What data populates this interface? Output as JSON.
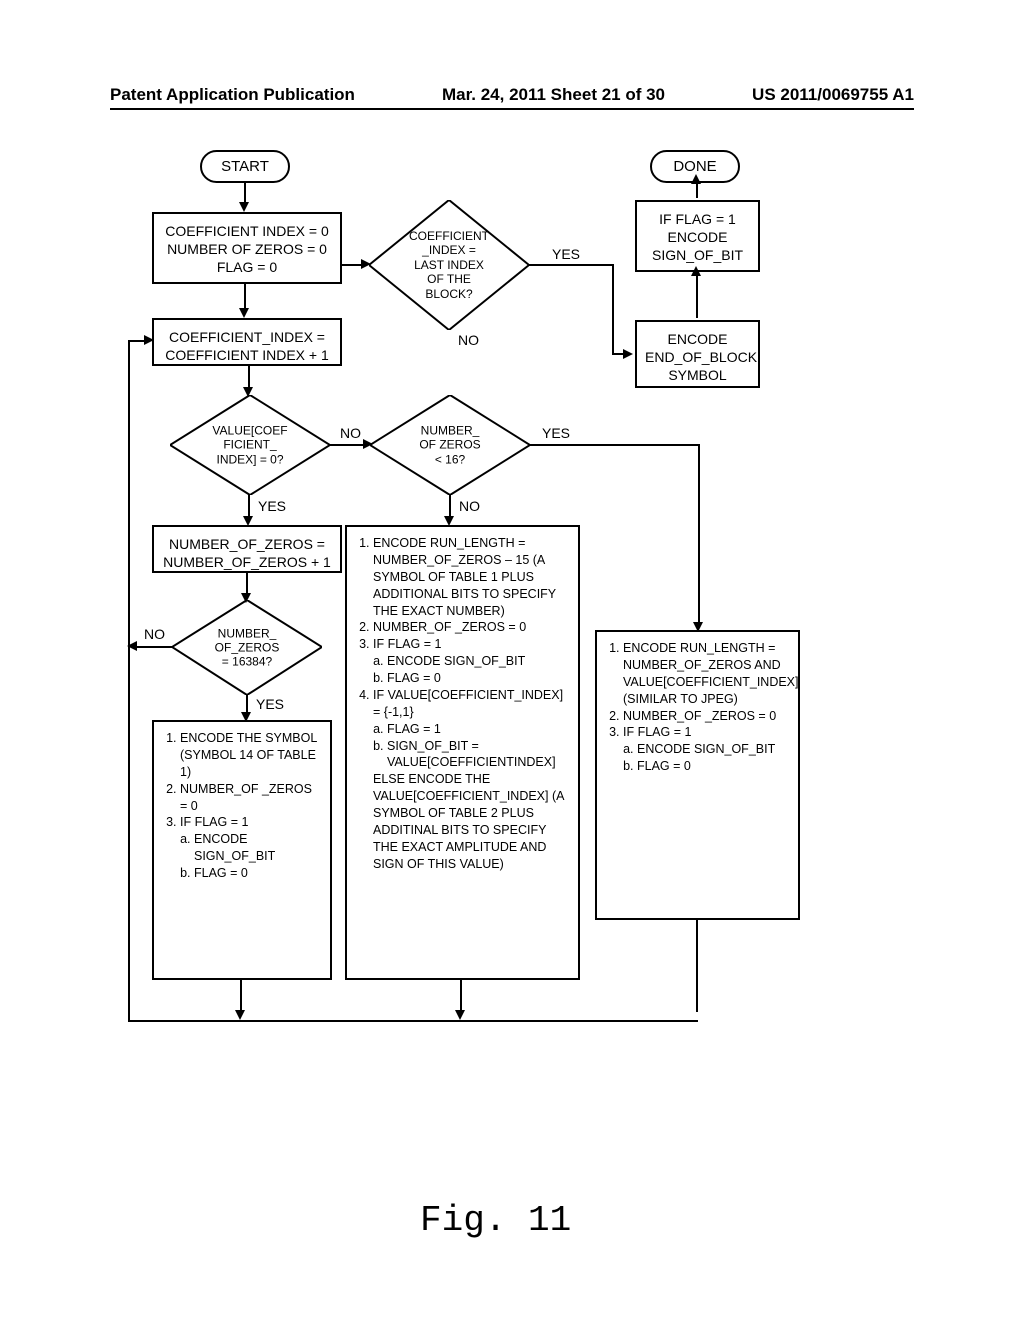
{
  "header": {
    "left": "Patent Application Publication",
    "center": "Mar. 24, 2011  Sheet 21 of 30",
    "right": "US 2011/0069755 A1"
  },
  "figure_caption": "Fig. 11",
  "nodes": {
    "start": "START",
    "done": "DONE",
    "init": "COEFFICIENT INDEX = 0\nNUMBER OF ZEROS = 0\nFLAG = 0",
    "increment": "COEFFICIENT_INDEX =\nCOEFFICIENT INDEX + 1",
    "last_index_q": "COEFFICIENT\n_INDEX =\nLAST INDEX\nOF THE\nBLOCK?",
    "flag_encode": "IF FLAG = 1\nENCODE\nSIGN_OF_BIT",
    "encode_eob": "ENCODE\nEND_OF_BLOCK\nSYMBOL",
    "value_zero_q": "VALUE[COEF\nFICIENT_\nINDEX] = 0?",
    "zeros_lt16_q": "NUMBER_\nOF ZEROS\n< 16?",
    "inc_zeros": "NUMBER_OF_ZEROS =\nNUMBER_OF_ZEROS + 1",
    "zeros_eq_q": "NUMBER_\nOF_ZEROS\n= 16384?",
    "encode_sym14": "1.   ENCODE THE SYMBOL (SYMBOL 14 OF TABLE 1)\n2.   NUMBER_OF_ZEROS = 0\n3.   IF FLAG = 1\n        a)   ENCODE SIGN_OF_BIT\n        b)   FLAG = 0",
    "encode_runlen_big": "1.   ENCODE RUN_LENGTH = NUMBER_OF_ZEROS – 15 (A SYMBOL OF TABLE 1 PLUS ADDITIONAL BITS TO SPECIFY THE EXACT NUMBER)\n2.   NUMBER_OF _ZEROS = 0\n3.   IF FLAG = 1\n        a)   ENCODE SIGN_OF_BIT\n        b)   FLAG = 0\n4.   IF VALUE[COEFFICIENT_INDEX] = {-1,1}\n        a)   FLAG = 1\n        b)   SIGN_OF_BIT = VALUE[COEFFICIENTINDEX]\n     ELSE ENCODE THE VALUE[COEFFICIENT_INDEX] (A SYMBOL OF TABLE 2 PLUS ADDITINAL BITS TO SPECIFY THE EXACT AMPLITUDE AND SIGN OF THIS VALUE)",
    "encode_runlen_small": "1.   ENCODE RUN_LENGTH = NUMBER_OF_ZEROS AND VALUE[COEFFICIENT_INDEX] (SIMILAR TO JPEG)\n2.   NUMBER_OF _ZEROS = 0\n3.   IF FLAG = 1\n        a)   ENCODE SIGN_OF_BIT\n        b)   FLAG = 0"
  },
  "labels": {
    "yes": "YES",
    "no": "NO"
  }
}
